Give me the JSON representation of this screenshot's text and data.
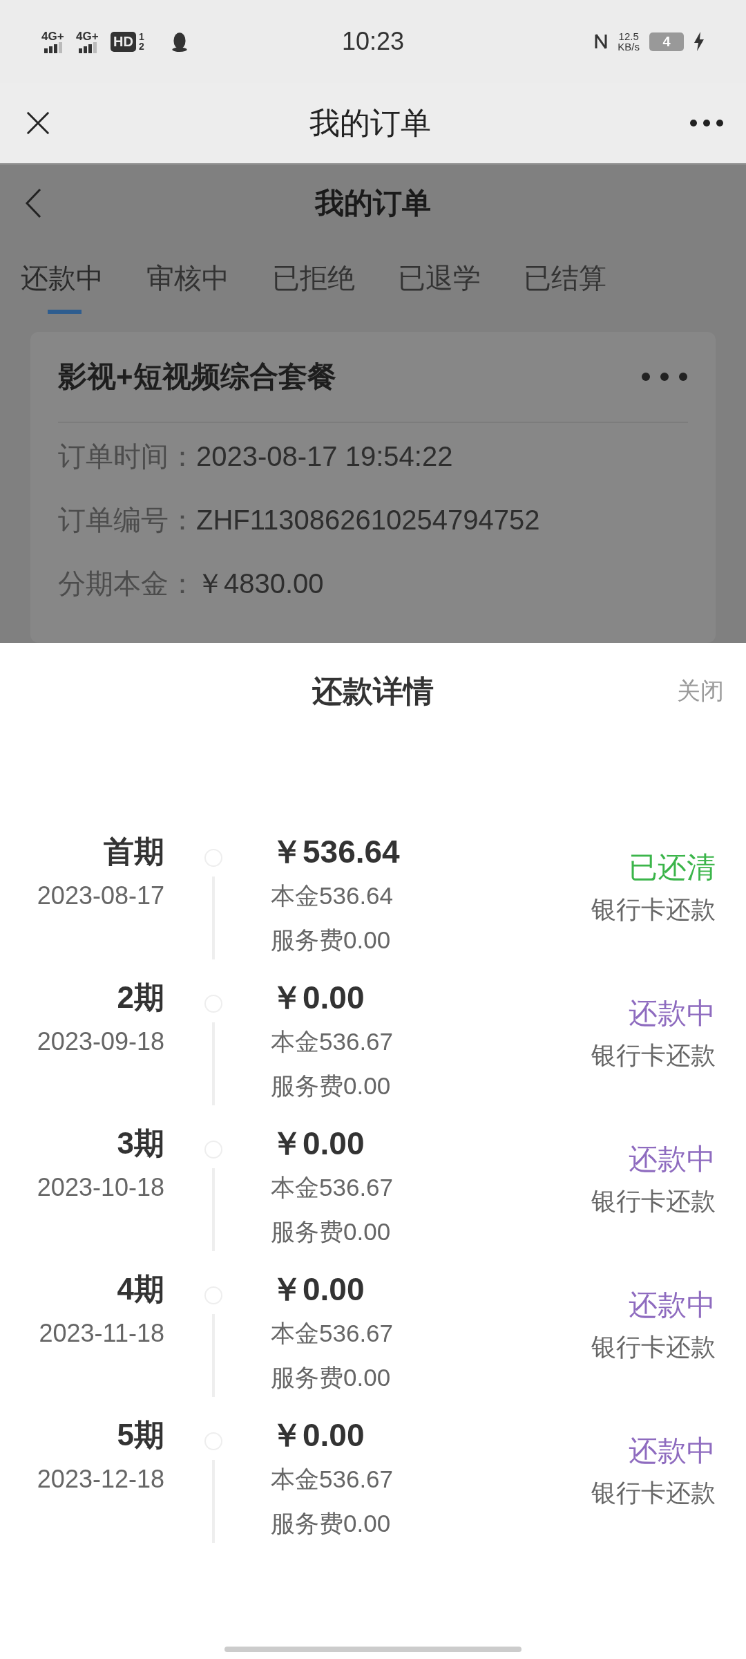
{
  "status_bar": {
    "network_labels": [
      "4G+",
      "4G+"
    ],
    "hd_label": "HD",
    "sim_labels": [
      "1",
      "2"
    ],
    "time": "10:23",
    "speed": "12.5",
    "speed_unit": "KB/s",
    "battery": "4"
  },
  "top_bar": {
    "title": "我的订单"
  },
  "page": {
    "title": "我的订单",
    "tabs": [
      {
        "label": "还款中",
        "selected": true
      },
      {
        "label": "审核中",
        "selected": false
      },
      {
        "label": "已拒绝",
        "selected": false
      },
      {
        "label": "已退学",
        "selected": false
      },
      {
        "label": "已结算",
        "selected": false
      }
    ],
    "order": {
      "title": "影视+短视频综合套餐",
      "fields": [
        {
          "label": "订单时间：",
          "value": "2023-08-17 19:54:22"
        },
        {
          "label": "订单编号：",
          "value": "ZHF1130862610254794752"
        },
        {
          "label": "分期本金：",
          "value": "￥4830.00"
        }
      ]
    }
  },
  "sheet": {
    "title": "还款详情",
    "close": "关闭",
    "installments": [
      {
        "period": "首期",
        "date": "2023-08-17",
        "amount": "￥536.64",
        "principal": "本金536.64",
        "fee": "服务费0.00",
        "status": "已还清",
        "color": "#3bb54a",
        "method": "银行卡还款"
      },
      {
        "period": "2期",
        "date": "2023-09-18",
        "amount": "￥0.00",
        "principal": "本金536.67",
        "fee": "服务费0.00",
        "status": "还款中",
        "color": "#8e6bbf",
        "method": "银行卡还款"
      },
      {
        "period": "3期",
        "date": "2023-10-18",
        "amount": "￥0.00",
        "principal": "本金536.67",
        "fee": "服务费0.00",
        "status": "还款中",
        "color": "#8e6bbf",
        "method": "银行卡还款"
      },
      {
        "period": "4期",
        "date": "2023-11-18",
        "amount": "￥0.00",
        "principal": "本金536.67",
        "fee": "服务费0.00",
        "status": "还款中",
        "color": "#8e6bbf",
        "method": "银行卡还款"
      },
      {
        "period": "5期",
        "date": "2023-12-18",
        "amount": "￥0.00",
        "principal": "本金536.67",
        "fee": "服务费0.00",
        "status": "还款中",
        "color": "#8e6bbf",
        "method": "银行卡还款"
      }
    ]
  }
}
